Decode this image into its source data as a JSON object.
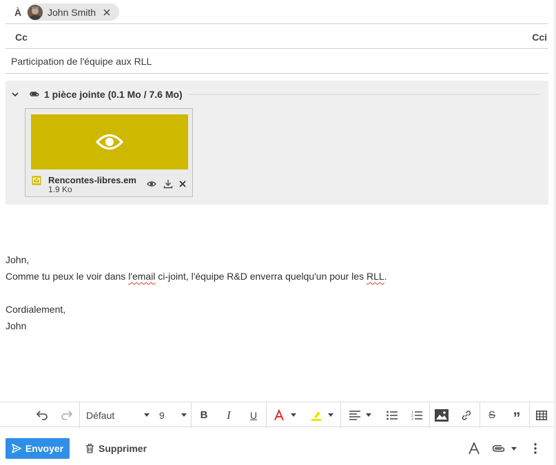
{
  "recipients": {
    "to_label": "À",
    "to": [
      {
        "name": "John Smith"
      }
    ],
    "cc_label": "Cc",
    "bcc_label": "Cci"
  },
  "subject": "Participation de l'équipe aux RLL",
  "attachments": {
    "summary": "1 pièce jointe (0.1 Mo / 7.6 Mo)",
    "files": [
      {
        "name": "Rencontes-libres.em",
        "size": "1.9 Ko",
        "preview_color": "#cfb800"
      }
    ]
  },
  "body": {
    "greeting": "John,",
    "line1_before": "Comme tu peux le voir dans ",
    "line1_spell1": "l'email",
    "line1_middle": " ci-joint, l'équipe R&D enverra quelqu'un pour les ",
    "line1_spell2": "RLL",
    "line1_after": ".",
    "closing": "Cordialement,",
    "signature": "John"
  },
  "toolbar": {
    "font_family": "Défaut",
    "font_size": "9",
    "icons": [
      "undo-icon",
      "redo-icon",
      "bold-icon",
      "italic-icon",
      "underline-icon",
      "text-color-icon",
      "highlight-icon",
      "align-icon",
      "bullet-list-icon",
      "numbered-list-icon",
      "image-icon",
      "link-icon",
      "strikethrough-icon",
      "quote-icon",
      "table-icon"
    ]
  },
  "footer": {
    "send_label": "Envoyer",
    "delete_label": "Supprimer"
  },
  "colors": {
    "accent": "#2f8fe6",
    "text_color_icon": "#d9342b",
    "highlight_icon": "#e5e800",
    "attachment_preview": "#cfb800"
  }
}
